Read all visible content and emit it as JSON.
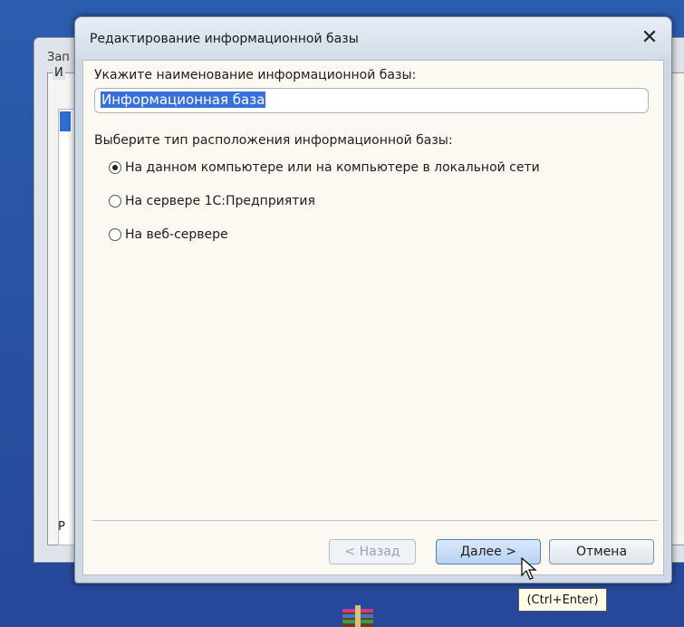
{
  "background_window": {
    "title_fragment": "Зап",
    "frame_label_fragment": "И",
    "bottom_label_fragment": "Р"
  },
  "dialog": {
    "title": "Редактирование информационной базы",
    "name_prompt": "Укажите наименование информационной базы:",
    "name_value": "Информационная база",
    "location_prompt": "Выберите тип расположения информационной базы:",
    "options": [
      {
        "label": "На данном компьютере или на компьютере в локальной сети",
        "checked": true
      },
      {
        "label": "На сервере 1С:Предприятия",
        "checked": false
      },
      {
        "label": "На веб-сервере",
        "checked": false
      }
    ],
    "buttons": {
      "back": "< Назад",
      "next": "Далее >",
      "cancel": "Отмена"
    }
  },
  "tooltip": "(Ctrl+Enter)",
  "colors": {
    "desktop": "#2a56a8",
    "selection": "#3670d8",
    "dialog_body": "#fbf9f2"
  }
}
